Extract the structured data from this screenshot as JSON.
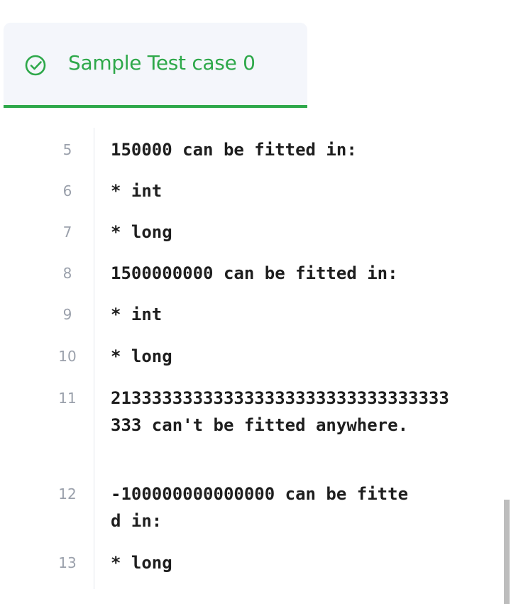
{
  "tab": {
    "title": "Sample Test case 0",
    "icon": "check-circle-icon",
    "accent_color": "#2ea84a"
  },
  "code": {
    "lines": [
      {
        "number": "5",
        "text": "150000 can be fitted in:"
      },
      {
        "number": "6",
        "text": "* int"
      },
      {
        "number": "7",
        "text": "* long"
      },
      {
        "number": "8",
        "text": "1500000000 can be fitted in:"
      },
      {
        "number": "9",
        "text": "* int"
      },
      {
        "number": "10",
        "text": "* long"
      },
      {
        "number": "11",
        "text": "213333333333333333333333333333333333 can't be fitted anywhere."
      },
      {
        "number": "12",
        "text": "-100000000000000 can be fitted in:"
      },
      {
        "number": "13",
        "text": "* long"
      }
    ]
  }
}
